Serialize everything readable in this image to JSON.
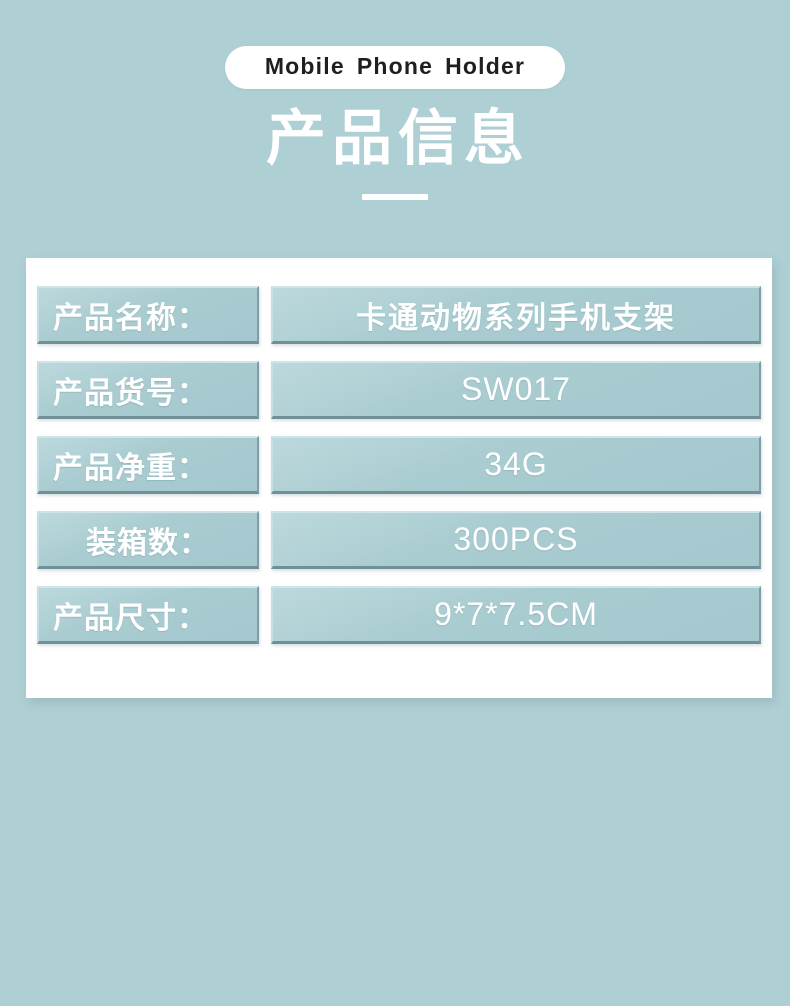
{
  "background_color": "#aecfd4",
  "cell_color": "#a9ccd1",
  "card_color": "#ffffff",
  "text_color": "#ffffff",
  "header": {
    "badge_words": [
      "Mobile",
      "Phone",
      "Holder"
    ],
    "badge_text": "Mobile  Phone  Holder",
    "title": "产品信息"
  },
  "table": {
    "rows": [
      {
        "label": "产品名称：",
        "value": "卡通动物系列手机支架",
        "value_is_cjk": true,
        "label_centered": false
      },
      {
        "label": "产品货号：",
        "value": "SW017",
        "value_is_cjk": false,
        "label_centered": false
      },
      {
        "label": "产品净重：",
        "value": "34G",
        "value_is_cjk": false,
        "label_centered": false
      },
      {
        "label": "装箱数：",
        "value": "300PCS",
        "value_is_cjk": false,
        "label_centered": true
      },
      {
        "label": "产品尺寸：",
        "value": "9*7*7.5CM",
        "value_is_cjk": false,
        "label_centered": false
      }
    ]
  }
}
